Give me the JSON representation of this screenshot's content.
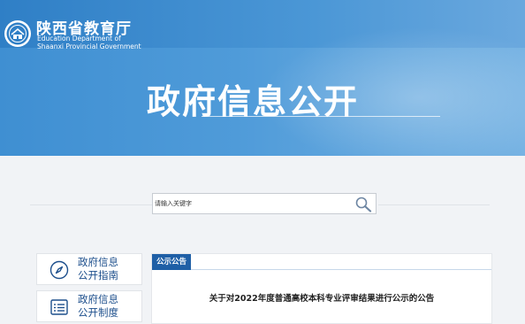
{
  "header": {
    "site_title": "陕西省教育厅",
    "site_subtitle_line1": "Education Department of",
    "site_subtitle_line2": "Shaanxi Provincial Government",
    "page_title": "政府信息公开"
  },
  "search": {
    "placeholder": "请输入关键字"
  },
  "sidebar": {
    "items": [
      {
        "line1": "政府信息",
        "line2": "公开指南",
        "icon": "compass-icon"
      },
      {
        "line1": "政府信息",
        "line2": "公开制度",
        "icon": "document-list-icon"
      }
    ]
  },
  "notice": {
    "tab_label": "公示公告",
    "title": "关于对2022年度普通高校本科专业评审结果进行公示的公告"
  },
  "colors": {
    "banner_blue": "#3f8fd2",
    "accent_blue": "#1f5fa6",
    "sidebar_text": "#1d4f8c"
  }
}
